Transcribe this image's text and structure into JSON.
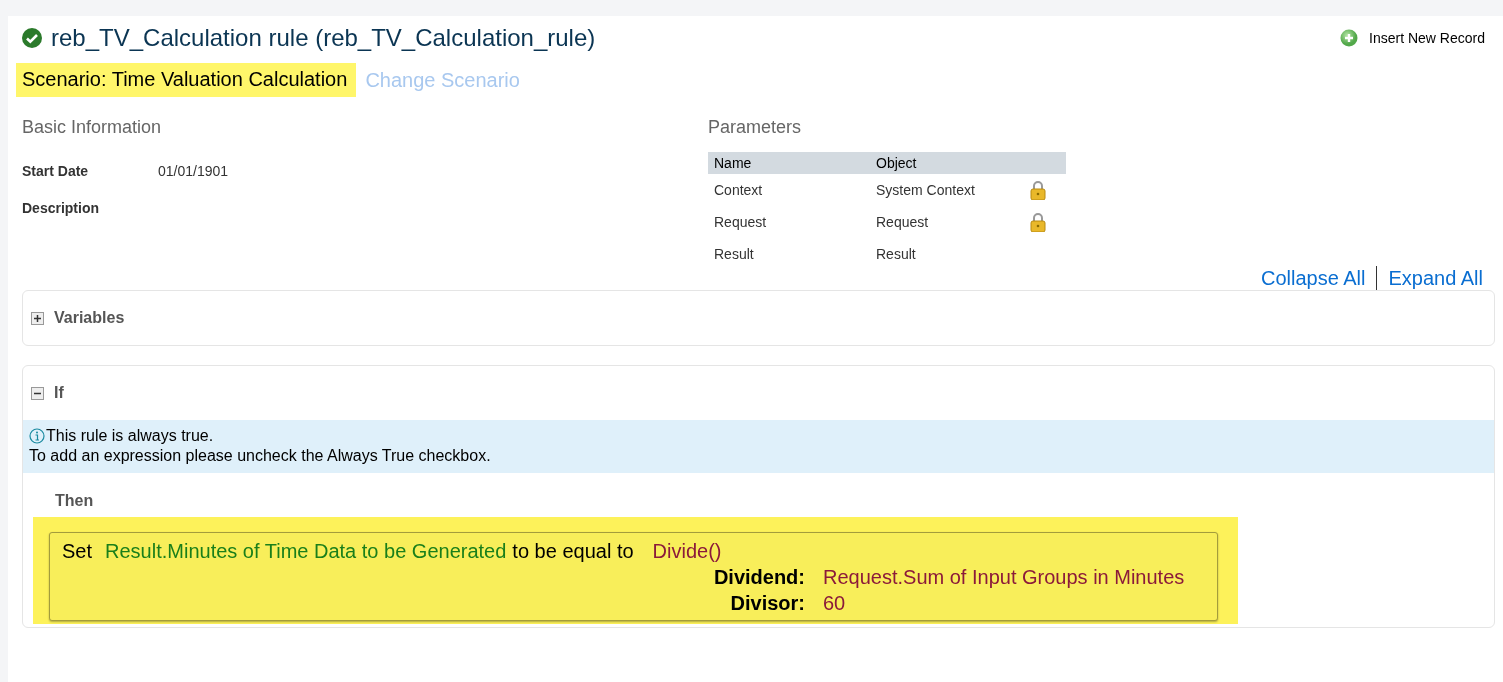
{
  "header": {
    "title": "reb_TV_Calculation rule (reb_TV_Calculation_rule)",
    "valid": true,
    "insert_action": "Insert New Record"
  },
  "scenario": {
    "label": "Scenario: Time Valuation Calculation",
    "change_link": "Change Scenario"
  },
  "basic_information": {
    "heading": "Basic Information",
    "fields": [
      {
        "label": "Start Date",
        "value": "01/01/1901"
      },
      {
        "label": "Description"
      }
    ]
  },
  "parameters": {
    "heading": "Parameters",
    "columns": [
      "Name",
      "Object"
    ],
    "rows": [
      {
        "name": "Context",
        "object": "System Context",
        "locked": true
      },
      {
        "name": "Request",
        "object": "Request",
        "locked": true
      },
      {
        "name": "Result",
        "object": "Result",
        "locked": false
      }
    ]
  },
  "toolbar": {
    "collapse_all": "Collapse All",
    "expand_all": "Expand All"
  },
  "sections": [
    {
      "title": "Variables",
      "expanded": false
    },
    {
      "title": "If",
      "expanded": true,
      "info": [
        "This rule is always true.",
        "To add an expression please uncheck the Always True checkbox."
      ],
      "then_label": "Then",
      "action": {
        "verb": "Set",
        "target": "Result.Minutes of Time Data to be Generated",
        "connector": "to be equal to",
        "function": "Divide()",
        "arguments": [
          {
            "label": "Dividend:",
            "value": "Request.Sum of Input Groups in Minutes"
          },
          {
            "label": "Divisor:",
            "value": "60"
          }
        ]
      }
    }
  ]
}
